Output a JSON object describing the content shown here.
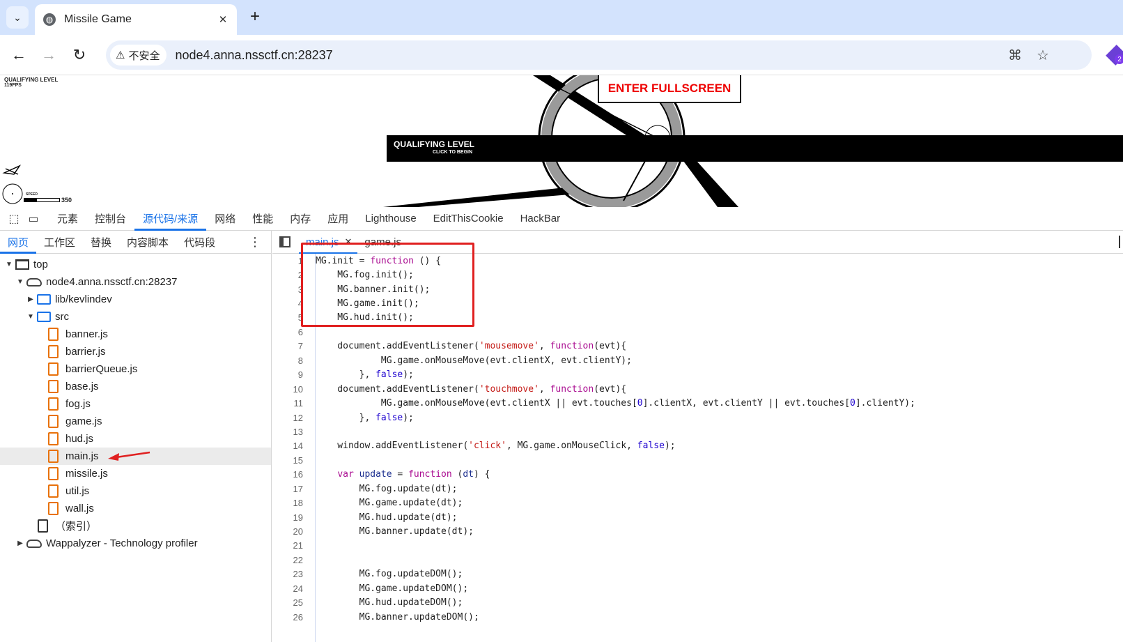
{
  "browser": {
    "tab_title": "Missile Game",
    "insecure_label": "不安全",
    "url": "node4.anna.nssctf.cn:28237",
    "extension_badge": "2"
  },
  "game": {
    "level_label": "QUALIFYING LEVEL",
    "fps": "119FPS",
    "fullscreen_label": "ENTER FULLSCREEN",
    "banner_title": "QUALIFYING LEVEL",
    "banner_subtitle": "CLICK TO BEGIN",
    "speed_label": "SPEED",
    "speed_value": "350",
    "speed_fraction": 0.35
  },
  "devtools": {
    "tabs": [
      "元素",
      "控制台",
      "源代码/来源",
      "网络",
      "性能",
      "内存",
      "应用",
      "Lighthouse",
      "EditThisCookie",
      "HackBar"
    ],
    "active_tab": 2,
    "nav_subtabs": [
      "网页",
      "工作区",
      "替换",
      "内容脚本",
      "代码段"
    ],
    "active_subtab": 0,
    "tree": {
      "top": "top",
      "origin": "node4.anna.nssctf.cn:28237",
      "folder_lib": "lib/kevlindev",
      "folder_src": "src",
      "files": [
        "banner.js",
        "barrier.js",
        "barrierQueue.js",
        "base.js",
        "fog.js",
        "game.js",
        "hud.js",
        "main.js",
        "missile.js",
        "util.js",
        "wall.js"
      ],
      "selected_file": "main.js",
      "index": "（索引）",
      "extension": "Wappalyzer - Technology profiler"
    },
    "editor_tabs": [
      "main.js",
      "game.js"
    ],
    "active_editor_tab": 0
  },
  "code_lines": [
    {
      "n": "1",
      "html": "MG.init = <span class=\"kw\">function</span> () {"
    },
    {
      "n": "2",
      "html": "    MG.fog.init();"
    },
    {
      "n": "3",
      "html": "    MG.banner.init();"
    },
    {
      "n": "4",
      "html": "    MG.game.init();"
    },
    {
      "n": "5",
      "html": "    MG.hud.init();"
    },
    {
      "n": "6",
      "html": ""
    },
    {
      "n": "7",
      "html": "    document.addEventListener(<span class=\"str\">'mousemove'</span>, <span class=\"kw\">function</span>(evt){"
    },
    {
      "n": "8",
      "html": "            MG.game.onMouseMove(evt.clientX, evt.clientY);"
    },
    {
      "n": "9",
      "html": "        }, <span class=\"num\">false</span>);"
    },
    {
      "n": "10",
      "html": "    document.addEventListener(<span class=\"str\">'touchmove'</span>, <span class=\"kw\">function</span>(evt){"
    },
    {
      "n": "11",
      "html": "            MG.game.onMouseMove(evt.clientX || evt.touches[<span class=\"num\">0</span>].clientX, evt.clientY || evt.touches[<span class=\"num\">0</span>].clientY);"
    },
    {
      "n": "12",
      "html": "        }, <span class=\"num\">false</span>);"
    },
    {
      "n": "13",
      "html": ""
    },
    {
      "n": "14",
      "html": "    window.addEventListener(<span class=\"str\">'click'</span>, MG.game.onMouseClick, <span class=\"num\">false</span>);"
    },
    {
      "n": "15",
      "html": ""
    },
    {
      "n": "16",
      "html": "    <span class=\"kw\">var</span> <span class=\"fn\">update</span> = <span class=\"kw\">function</span> (<span class=\"fn\">dt</span>) {"
    },
    {
      "n": "17",
      "html": "        MG.fog.update(dt);"
    },
    {
      "n": "18",
      "html": "        MG.game.update(dt);"
    },
    {
      "n": "19",
      "html": "        MG.hud.update(dt);"
    },
    {
      "n": "20",
      "html": "        MG.banner.update(dt);"
    },
    {
      "n": "21",
      "html": ""
    },
    {
      "n": "22",
      "html": ""
    },
    {
      "n": "23",
      "html": "        MG.fog.updateDOM();"
    },
    {
      "n": "24",
      "html": "        MG.game.updateDOM();"
    },
    {
      "n": "25",
      "html": "        MG.hud.updateDOM();"
    },
    {
      "n": "26",
      "html": "        MG.banner.updateDOM();"
    }
  ]
}
